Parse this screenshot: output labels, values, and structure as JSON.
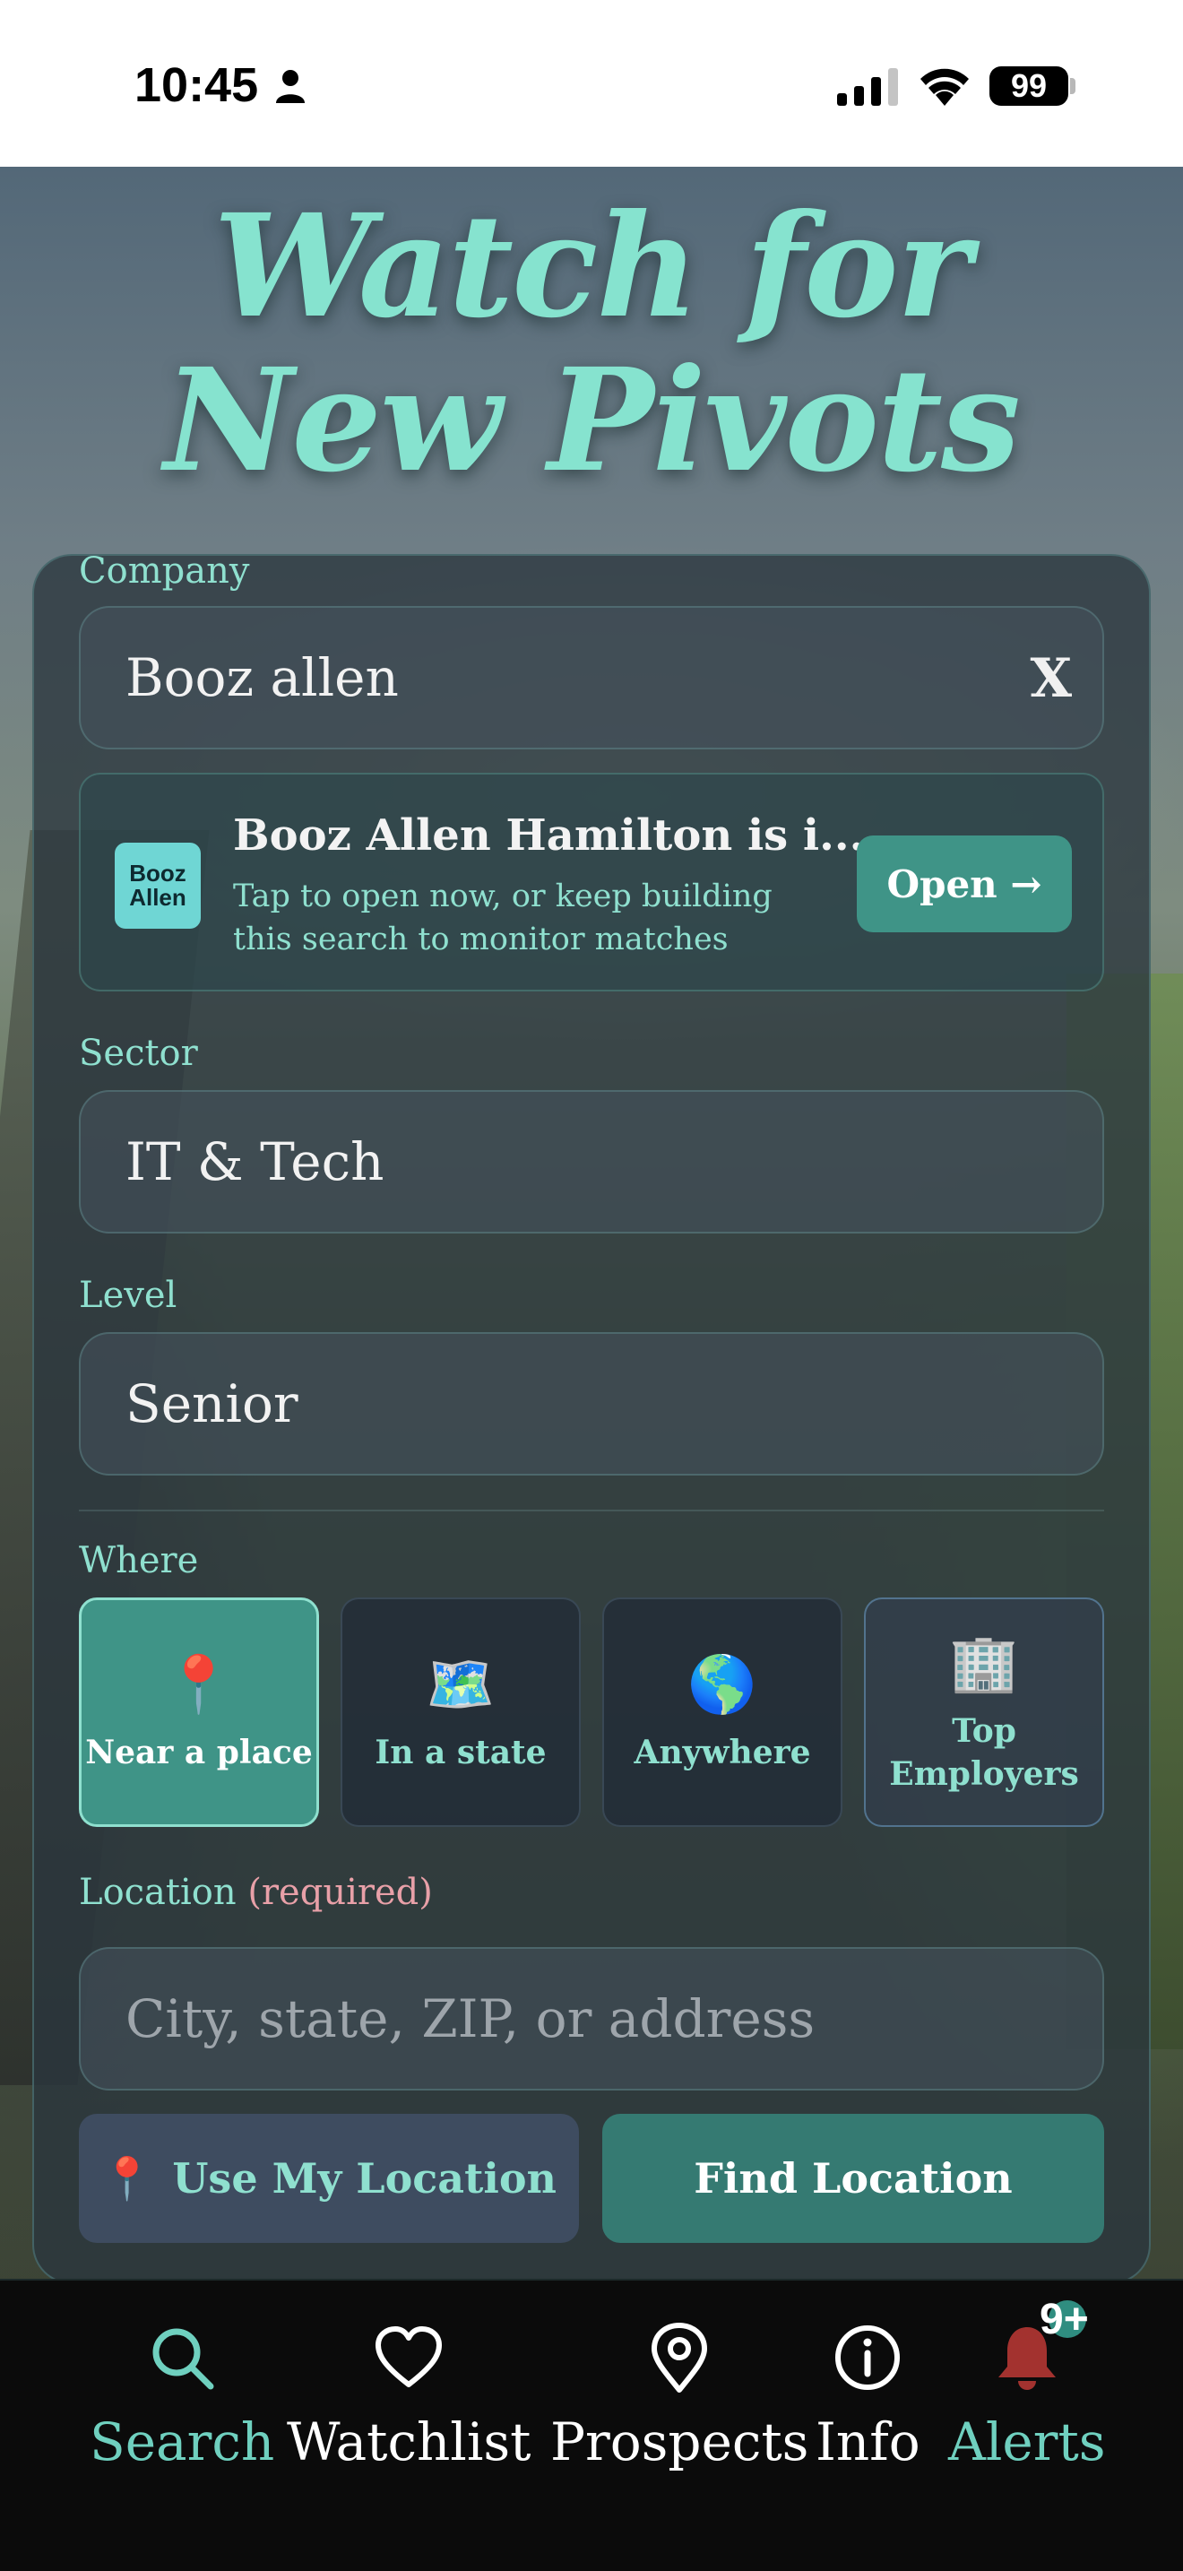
{
  "status_bar": {
    "time": "10:45",
    "battery": "99"
  },
  "headline": {
    "line1": "Watch for",
    "line2": "New Pivots"
  },
  "company": {
    "label": "Company",
    "value": "Booz allen",
    "clear": "X"
  },
  "suggestion": {
    "logo_line1": "Booz",
    "logo_line2": "Allen",
    "title": "Booz Allen Hamilton is i...",
    "subtitle": "Tap to open now, or keep building this search to monitor matches",
    "button": "Open →"
  },
  "sector": {
    "label": "Sector",
    "value": "IT & Tech"
  },
  "level": {
    "label": "Level",
    "value": "Senior"
  },
  "where": {
    "label": "Where",
    "options": [
      {
        "icon": "📍",
        "label": "Near a place",
        "selected": true
      },
      {
        "icon": "🗺️",
        "label": "In a state",
        "selected": false
      },
      {
        "icon": "🌎",
        "label": "Anywhere",
        "selected": false
      },
      {
        "icon": "🏢",
        "label": "Top Employers",
        "selected": false
      }
    ]
  },
  "location": {
    "label": "Location",
    "required": "(required)",
    "placeholder": "City, state, ZIP, or address",
    "use_my_location_icon": "📍",
    "use_my_location": "Use My Location",
    "find_location": "Find Location"
  },
  "tabs": [
    {
      "icon": "search-icon",
      "label": "Search",
      "active": true
    },
    {
      "icon": "heart-icon",
      "label": "Watchlist",
      "active": false
    },
    {
      "icon": "pin-icon",
      "label": "Prospects",
      "active": false
    },
    {
      "icon": "info-icon",
      "label": "Info",
      "active": false
    },
    {
      "icon": "bell-icon",
      "label": "Alerts",
      "active": false
    }
  ],
  "alerts_badge": "9+",
  "colors": {
    "accent": "#8fe0cf",
    "button_teal": "#3f9487",
    "required_pink": "#e8a0a8",
    "tab_bar": "#0b0b0b"
  }
}
